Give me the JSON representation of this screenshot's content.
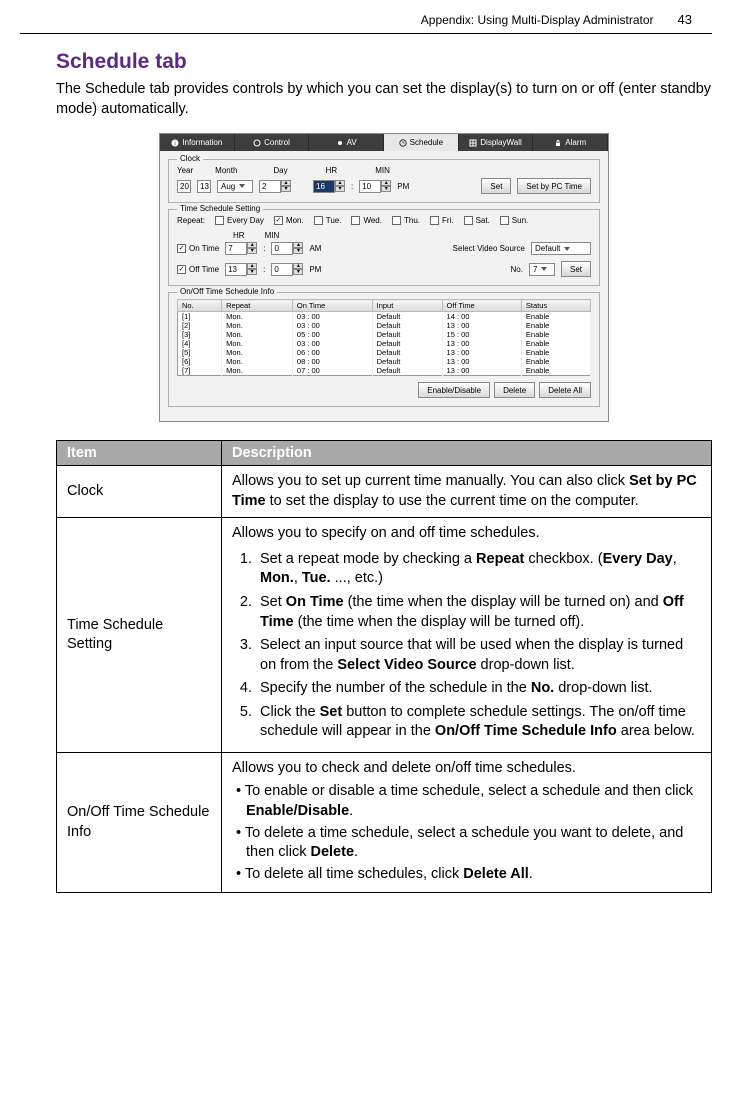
{
  "header": {
    "title": "Appendix: Using Multi-Display Administrator",
    "page": "43"
  },
  "section": {
    "title": "Schedule tab",
    "intro": "The Schedule tab provides controls by which you can set the display(s) to turn on or off (enter standby mode) automatically."
  },
  "ss": {
    "tabs": [
      "Information",
      "Control",
      "AV",
      "Schedule",
      "DisplayWall",
      "Alarm"
    ],
    "clock": {
      "group": "Clock",
      "year_lbl": "Year",
      "year": "20",
      "year2": "13",
      "month_lbl": "Month",
      "month": "Aug",
      "day_lbl": "Day",
      "day": "2",
      "hr_lbl": "HR",
      "hr": "16",
      "min_lbl": "MIN",
      "min": "10",
      "ampm": "PM",
      "set_btn": "Set",
      "pc_btn": "Set by PC Time"
    },
    "tss": {
      "group": "Time Schedule Setting",
      "repeat_lbl": "Repeat:",
      "days": [
        {
          "lbl": "Every Day",
          "chk": false
        },
        {
          "lbl": "Mon.",
          "chk": true
        },
        {
          "lbl": "Tue.",
          "chk": false
        },
        {
          "lbl": "Wed.",
          "chk": false
        },
        {
          "lbl": "Thu.",
          "chk": false
        },
        {
          "lbl": "Fri.",
          "chk": false
        },
        {
          "lbl": "Sat.",
          "chk": false
        },
        {
          "lbl": "Sun.",
          "chk": false
        }
      ],
      "hr_lbl": "HR",
      "min_lbl": "MIN",
      "on_lbl": "On Time",
      "on_hr": "7",
      "on_min": "0",
      "on_ampm": "AM",
      "off_lbl": "Off Time",
      "off_hr": "13",
      "off_min": "0",
      "off_ampm": "PM",
      "src_lbl": "Select Video Source",
      "src": "Default",
      "no_lbl": "No.",
      "no": "7",
      "set_btn": "Set"
    },
    "info": {
      "group": "On/Off Time Schedule Info",
      "headers": [
        "No.",
        "Repeat",
        "On Time",
        "Input",
        "Off Time",
        "Status"
      ],
      "rows": [
        [
          "[1]",
          "Mon.",
          "03 : 00",
          "Default",
          "14 : 00",
          "Enable"
        ],
        [
          "[2]",
          "Mon.",
          "03 : 00",
          "Default",
          "13 : 00",
          "Enable"
        ],
        [
          "[3]",
          "Mon.",
          "05 : 00",
          "Default",
          "15 : 00",
          "Enable"
        ],
        [
          "[4]",
          "Mon.",
          "03 : 00",
          "Default",
          "13 : 00",
          "Enable"
        ],
        [
          "[5]",
          "Mon.",
          "06 : 00",
          "Default",
          "13 : 00",
          "Enable"
        ],
        [
          "[6]",
          "Mon.",
          "08 : 00",
          "Default",
          "13 : 00",
          "Enable"
        ],
        [
          "[7]",
          "Mon.",
          "07 : 00",
          "Default",
          "13 : 00",
          "Enable"
        ]
      ],
      "enable_btn": "Enable/Disable",
      "delete_btn": "Delete",
      "delete_all_btn": "Delete All"
    }
  },
  "table": {
    "h_item": "Item",
    "h_desc": "Description",
    "r1_item": "Clock",
    "r1_pre": "Allows you to set up current time manually. You can also click ",
    "r1_bold": "Set by PC Time",
    "r1_post": " to set the display to use the current time on the computer.",
    "r2_item": "Time Schedule Setting",
    "r2_intro": "Allows you to specify on and off time schedules.",
    "r2_s1a": "Set a repeat mode by checking a ",
    "r2_s1b": "Repeat",
    "r2_s1c": " checkbox. (",
    "r2_s1d": "Every Day",
    "r2_s1e": ", ",
    "r2_s1f": "Mon.",
    "r2_s1g": ", ",
    "r2_s1h": "Tue.",
    "r2_s1i": " ..., etc.)",
    "r2_s2a": "Set ",
    "r2_s2b": "On Time",
    "r2_s2c": " (the time when the display will be turned on) and ",
    "r2_s2d": "Off Time",
    "r2_s2e": " (the time when the display will be turned off).",
    "r2_s3a": "Select an input source that will be used when the display is turned on from the ",
    "r2_s3b": "Select Video Source",
    "r2_s3c": " drop-down list.",
    "r2_s4a": "Specify the number of the schedule in the ",
    "r2_s4b": "No.",
    "r2_s4c": " drop-down list.",
    "r2_s5a": "Click the ",
    "r2_s5b": "Set",
    "r2_s5c": " button to complete schedule settings. The on/off time schedule will appear in the ",
    "r2_s5d": "On/Off Time Schedule Info",
    "r2_s5e": " area below.",
    "r3_item": "On/Off Time Schedule Info",
    "r3_intro": "Allows you to check and delete on/off time schedules.",
    "r3_b1a": "To enable or disable a time schedule, select a schedule and then click ",
    "r3_b1b": "Enable/Disable",
    "r3_b1c": ".",
    "r3_b2a": "To delete a time schedule, select a schedule you want to delete, and then click ",
    "r3_b2b": "Delete",
    "r3_b2c": ".",
    "r3_b3a": "To delete all time schedules, click ",
    "r3_b3b": "Delete All",
    "r3_b3c": "."
  }
}
